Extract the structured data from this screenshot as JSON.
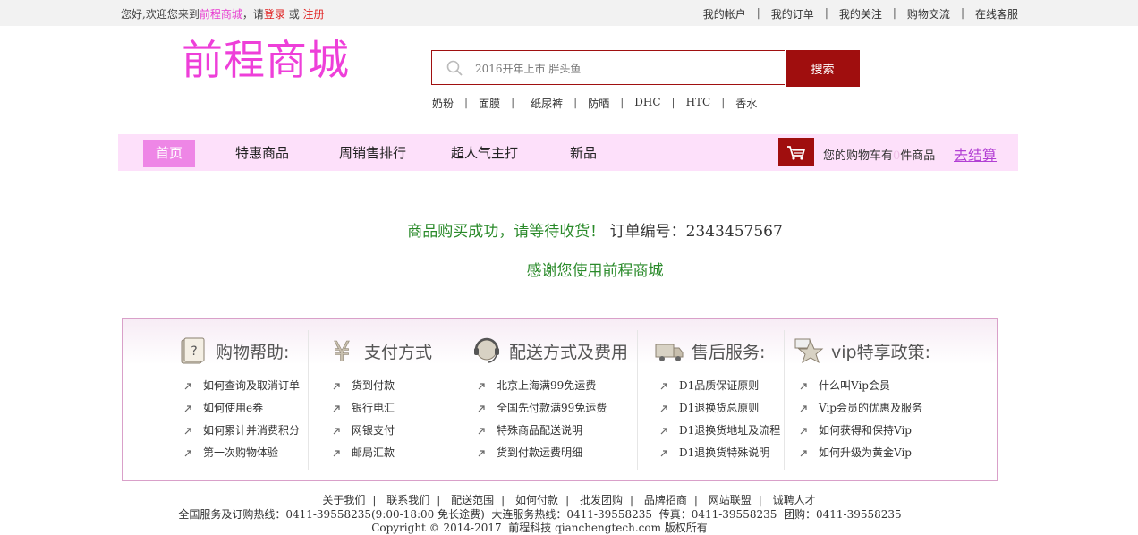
{
  "topbar": {
    "welcome_prefix": "您好,欢迎您来到",
    "site_name": "前程商城",
    "welcome_mid": "，请",
    "login": "登录",
    "or": " 或 ",
    "register": "注册",
    "links": [
      "我的帐户",
      "我的订单",
      "我的关注",
      "购物交流",
      "在线客服"
    ]
  },
  "header": {
    "logo": "前程商城",
    "search_placeholder": "2016开年上市 胖头鱼",
    "search_button": "搜索",
    "hotwords": [
      "奶粉",
      "面膜",
      "纸尿裤",
      "防晒",
      "DHC",
      "HTC",
      "香水"
    ]
  },
  "nav": {
    "items": [
      "首页",
      "特惠商品",
      "周销售排行",
      "超人气主打",
      "新品"
    ],
    "cart_prefix": "您的购物车有",
    "cart_count": "0",
    "cart_suffix": "件商品",
    "checkout": "去结算"
  },
  "message": {
    "success": "商品购买成功，请等待收货！",
    "order_label": "订单编号：",
    "order_no": "2343457567",
    "thanks": "感谢您使用前程商城"
  },
  "help": {
    "columns": [
      {
        "icon": "help-book-icon",
        "title": "购物帮助:",
        "items": [
          "如何查询及取消订单",
          "如何使用e券",
          "如何累计并消费积分",
          "第一次购物体验"
        ]
      },
      {
        "icon": "yen-icon",
        "title": "支付方式",
        "items": [
          "货到付款",
          "银行电汇",
          "网银支付",
          "邮局汇款"
        ]
      },
      {
        "icon": "headset-icon",
        "title": "配送方式及费用",
        "items": [
          "北京上海满99免运费",
          "全国先付款满99免运费",
          "特殊商品配送说明",
          "货到付款运费明细"
        ]
      },
      {
        "icon": "truck-icon",
        "title": "售后服务:",
        "items": [
          "D1品质保证原则",
          "D1退换货总原则",
          "D1退换货地址及流程",
          "D1退换货特殊说明"
        ]
      },
      {
        "icon": "star-icon",
        "title": "vip特享政策:",
        "items": [
          "什么叫Vip会员",
          "Vip会员的优惠及服务",
          "如何获得和保持Vip",
          "如何升级为黄金Vip"
        ]
      }
    ]
  },
  "footer": {
    "links": [
      "关于我们",
      "联系我们",
      "配送范围",
      "如何付款",
      "批发团购",
      "品牌招商",
      "网站联盟",
      "诚聘人才"
    ],
    "hotline": "全国服务及订购热线：0411-39558235(9:00-18:00 免长途费)  大连服务热线：0411-39558235  传真：0411-39558235  团购：0411-39558235",
    "copyright": "Copyright © 2014-2017  前程科技 qianchengtech.com 版权所有"
  },
  "colors": {
    "brand_pink": "#ee3fd9",
    "dark_red": "#a00e0e",
    "nav_bg": "#fde0fa",
    "success_green": "#2a8a2a"
  }
}
